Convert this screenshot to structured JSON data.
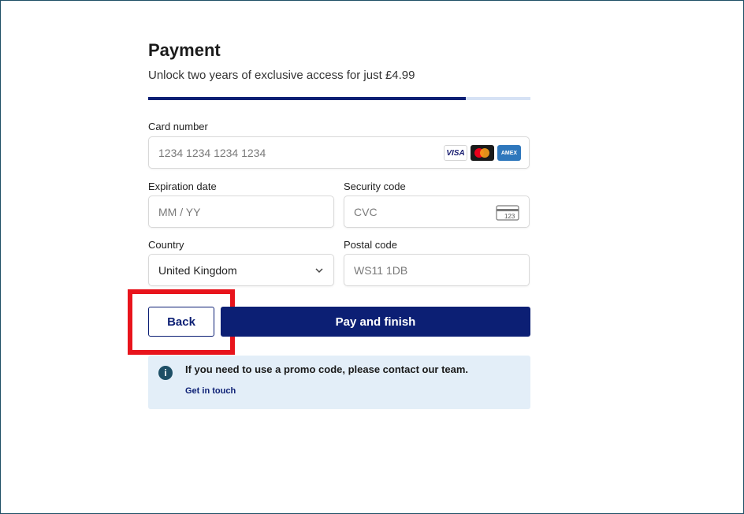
{
  "page": {
    "title": "Payment",
    "subtitle": "Unlock two years of exclusive access for just £4.99",
    "progress_percent": 83
  },
  "form": {
    "card_number": {
      "label": "Card number",
      "placeholder": "1234 1234 1234 1234",
      "card_brands": [
        "VISA",
        "mastercard",
        "AMEX"
      ]
    },
    "expiration": {
      "label": "Expiration date",
      "placeholder": "MM / YY"
    },
    "security": {
      "label": "Security code",
      "placeholder": "CVC",
      "icon_text": "123"
    },
    "country": {
      "label": "Country",
      "value": "United Kingdom"
    },
    "postal": {
      "label": "Postal code",
      "placeholder": "WS11 1DB"
    }
  },
  "actions": {
    "back_label": "Back",
    "pay_label": "Pay and finish"
  },
  "info": {
    "text": "If you need to use a promo code, please contact our team.",
    "link": "Get in touch"
  },
  "colors": {
    "primary": "#0c1f74",
    "highlight": "#e8141c",
    "info_bg": "#e3eef8"
  },
  "icons": {
    "info": "info-icon",
    "cvc": "card-cvc-icon",
    "chevron": "chevron-down-icon"
  }
}
